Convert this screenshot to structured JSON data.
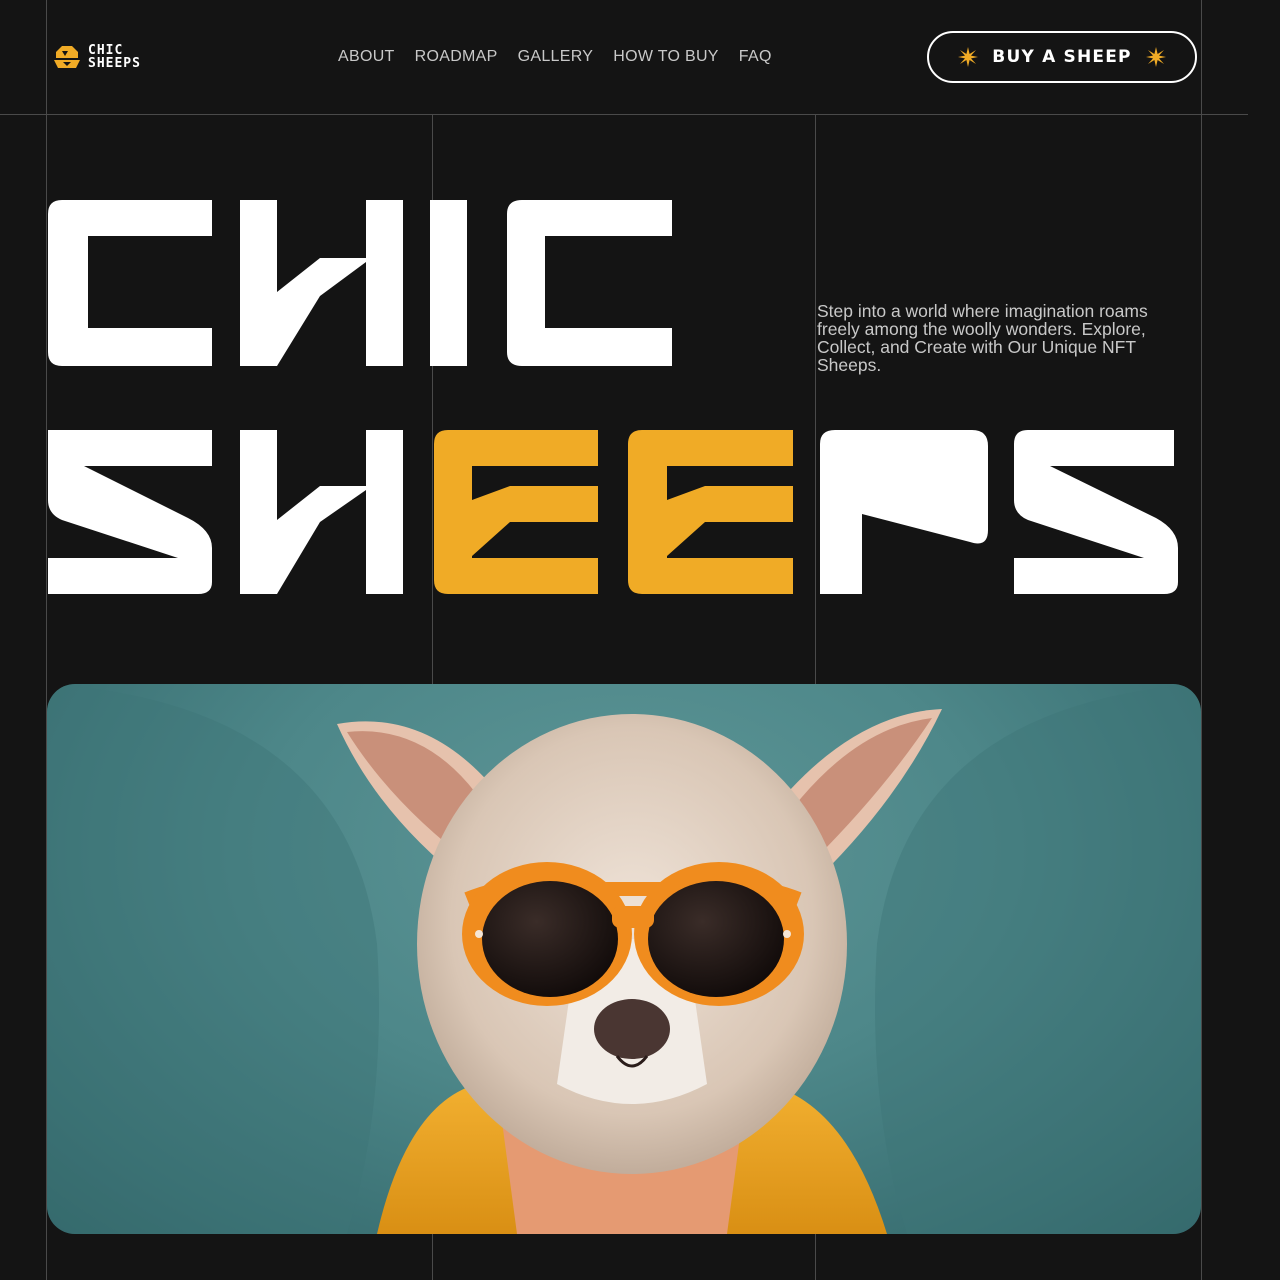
{
  "brand": {
    "line1": "CHIC",
    "line2": "SHEEPS",
    "logo_icon": "sheep-logo-icon",
    "accent": "#f0ab26"
  },
  "nav": {
    "items": [
      {
        "label": "ABOUT"
      },
      {
        "label": "ROADMAP"
      },
      {
        "label": "GALLERY"
      },
      {
        "label": "HOW TO BUY"
      },
      {
        "label": "FAQ"
      }
    ]
  },
  "cta": {
    "label": "BUY A SHEEP",
    "icon": "sparkle-star-icon",
    "accent": "#f0ab26"
  },
  "hero": {
    "title_line1": "CHIC",
    "title_line2": "SHEEPS",
    "tagline": "Step into a world where imagination roams freely among the woolly wonders. Explore, Collect, and Create with Our Unique NFT Sheeps."
  },
  "colors": {
    "background": "#141414",
    "text": "#ffffff",
    "muted": "#c8c8c8",
    "accent": "#f0ab26",
    "image_bg": "#4d8789"
  }
}
